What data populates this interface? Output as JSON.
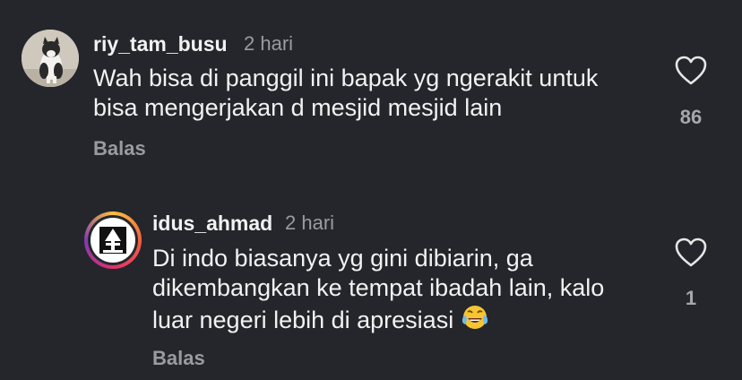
{
  "comments": [
    {
      "username": "riy_tam_busu",
      "time": "2 hari",
      "text_lines": [
        "Wah bisa di panggil ini bapak yg ngerakit untuk",
        "bisa mengerjakan d mesjid mesjid lain"
      ],
      "reply_label": "Balas",
      "likes": "86",
      "avatar_icon": "cat-photo-avatar",
      "like_icon": "heart-outline-icon"
    },
    {
      "username": "idus_ahmad",
      "time": "2 hari",
      "text_lines": [
        "Di indo biasanya yg gini dibiarin, ga",
        "dikembangkan ke tempat ibadah lain, kalo",
        "luar negeri lebih di apresiasi"
      ],
      "emoji": "tears-of-joy-emoji",
      "reply_label": "Balas",
      "likes": "1",
      "avatar_icon": "logo-avatar-with-story-ring",
      "like_icon": "heart-outline-icon"
    }
  ],
  "colors": {
    "background": "#25262b",
    "text": "#f2f2f2",
    "muted": "#9a9ba0",
    "story_ring": [
      "#f9c23c",
      "#f56040",
      "#e1306c",
      "#833ab4"
    ]
  }
}
